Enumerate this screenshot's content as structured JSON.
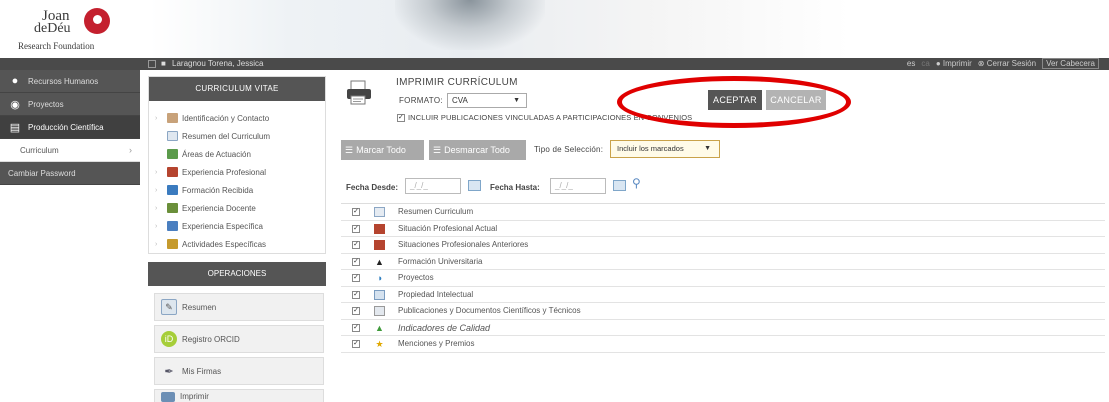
{
  "logo": {
    "line1": "Joan",
    "line2": "deDéu",
    "line3": "Research Foundation"
  },
  "topbar": {
    "user_name": "Laragnou Torena, Jessica",
    "lang": "es",
    "lang_alt": "ca",
    "print": "Imprimir",
    "logout": "Cerrar Sesión",
    "ver_cabecera": "Ver Cabecera"
  },
  "sidebar": {
    "items": [
      {
        "label": "Recursos Humanos",
        "icon": "user-icon"
      },
      {
        "label": "Proyectos",
        "icon": "globe-icon"
      },
      {
        "label": "Producción Científica",
        "icon": "document-icon"
      },
      {
        "label": "Curriculum",
        "icon": "chevron-right-icon"
      },
      {
        "label": "Cambiar Password",
        "icon": ""
      }
    ]
  },
  "cv_panel": {
    "title": "CURRICULUM VITAE",
    "items": [
      {
        "label": "Identificación y Contacto",
        "icon": "id-card-icon",
        "color": "#c8a27a"
      },
      {
        "label": "Resumen del Curriculum",
        "icon": "summary-icon",
        "color": "#8ba6c4"
      },
      {
        "label": "Áreas de Actuación",
        "icon": "areas-icon",
        "color": "#5b9b4b"
      },
      {
        "label": "Experiencia Profesional",
        "icon": "briefcase-icon",
        "color": "#b5442f"
      },
      {
        "label": "Formación Recibida",
        "icon": "education-icon",
        "color": "#3b7bbf"
      },
      {
        "label": "Experiencia Docente",
        "icon": "teaching-icon",
        "color": "#6a8f3a"
      },
      {
        "label": "Experiencia Específica",
        "icon": "specific-icon",
        "color": "#4a7fc0"
      },
      {
        "label": "Actividades Específicas",
        "icon": "activities-icon",
        "color": "#c59a2d"
      }
    ]
  },
  "operations": {
    "title": "OPERACIONES",
    "items": [
      {
        "label": "Resumen",
        "icon": "summary-edit-icon"
      },
      {
        "label": "Registro ORCID",
        "icon": "orcid-icon"
      },
      {
        "label": "Mis Firmas",
        "icon": "signature-icon"
      },
      {
        "label": "Imprimir",
        "icon": "printer-icon"
      }
    ]
  },
  "print_form": {
    "title": "IMPRIMIR CURRÍCULUM",
    "format_label": "FORMATO:",
    "format_value": "CVA",
    "include_label": "INCLUIR PUBLICACIONES VINCULADAS A PARTICIPACIONES EN CONVENIOS",
    "include_checked": true,
    "accept": "ACEPTAR",
    "cancel": "CANCELAR",
    "mark_all": "Marcar Todo",
    "unmark_all": "Desmarcar Todo",
    "selection_type_label": "Tipo de Selección:",
    "selection_type_value": "Incluir los marcados",
    "date_from_label": "Fecha Desde:",
    "date_to_label": "Fecha Hasta:",
    "date_placeholder": "_/_/_"
  },
  "sections": [
    {
      "label": "Resumen Curriculum",
      "icon": "summary-icon",
      "checked": true,
      "italic": false
    },
    {
      "label": "Situación Profesional Actual",
      "icon": "briefcase-icon",
      "checked": true,
      "italic": false
    },
    {
      "label": "Situaciones Profesionales Anteriores",
      "icon": "briefcase-icon",
      "checked": true,
      "italic": false
    },
    {
      "label": "Formación Universitaria",
      "icon": "graduation-cap-icon",
      "checked": true,
      "italic": false
    },
    {
      "label": "Proyectos",
      "icon": "project-icon",
      "checked": true,
      "italic": false
    },
    {
      "label": "Propiedad Intelectual",
      "icon": "intellectual-property-icon",
      "checked": true,
      "italic": false
    },
    {
      "label": "Publicaciones y Documentos Científicos y Técnicos",
      "icon": "publications-icon",
      "checked": true,
      "italic": false
    },
    {
      "label": "Indicadores de Calidad",
      "icon": "quality-chart-icon",
      "checked": true,
      "italic": true
    },
    {
      "label": "Menciones y Premios",
      "icon": "star-icon",
      "checked": true,
      "italic": false
    }
  ]
}
